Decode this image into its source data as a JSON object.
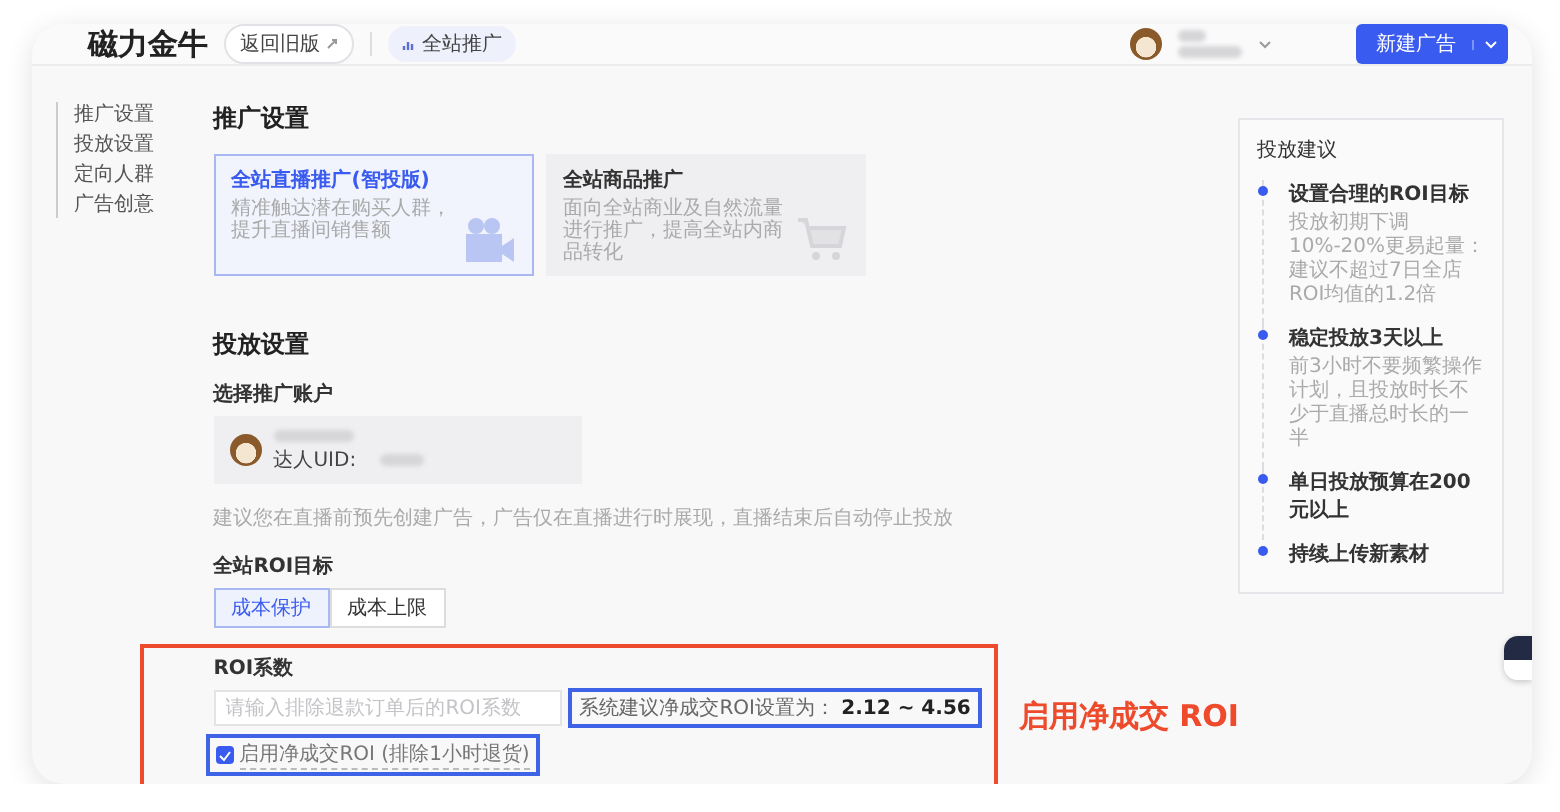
{
  "header": {
    "logo": "磁力金牛",
    "back_button": "返回旧版",
    "tab": "全站推广",
    "create_button": "新建广告"
  },
  "nav": [
    {
      "label": "推广设置"
    },
    {
      "label": "投放设置"
    },
    {
      "label": "定向人群"
    },
    {
      "label": "广告创意"
    }
  ],
  "promo_section": {
    "title": "推广设置",
    "options": [
      {
        "title": "全站直播推广(智投版)",
        "description": "精准触达潜在购买人群，提升直播间销售额",
        "selected": true,
        "kind": "video"
      },
      {
        "title": "全站商品推广",
        "description": "面向全站商业及自然流量进行推广，提高全站内商品转化",
        "selected": false,
        "kind": "cart"
      }
    ]
  },
  "delivery": {
    "title": "投放设置",
    "account_label": "选择推广账户",
    "uid_label": "达人UID:",
    "notice": "建议您在直播前预先创建广告，广告仅在直播进行时展现，直播结束后自动停止投放",
    "roi_goal_label": "全站ROI目标",
    "roi_goals": [
      {
        "label": "成本保护",
        "selected": true
      },
      {
        "label": "成本上限",
        "selected": false
      }
    ],
    "roi_label": "ROI系数",
    "roi_placeholder": "请输入排除退款订单后的ROI系数",
    "suggestion": "系统建议净成交ROI设置为： **2.12 ~ 4.56**",
    "net_roi": {
      "label": "启用净成交ROI (排除1小时退货)",
      "checked": true
    }
  },
  "tips": {
    "title": "投放建议",
    "items": [
      {
        "title": "设置合理的ROI目标",
        "detail": "投放初期下调10%-20%更易起量：建议不超过7日全店ROI均值的1.2倍"
      },
      {
        "title": "稳定投放3天以上",
        "detail": "前3小时不要频繁操作计划，且投放时长不少于直播总时长的一半"
      },
      {
        "title": "单日投放预算在200元以上"
      },
      {
        "title": "持续上传新素材"
      }
    ]
  },
  "annotation": "启用净成交 ROI"
}
